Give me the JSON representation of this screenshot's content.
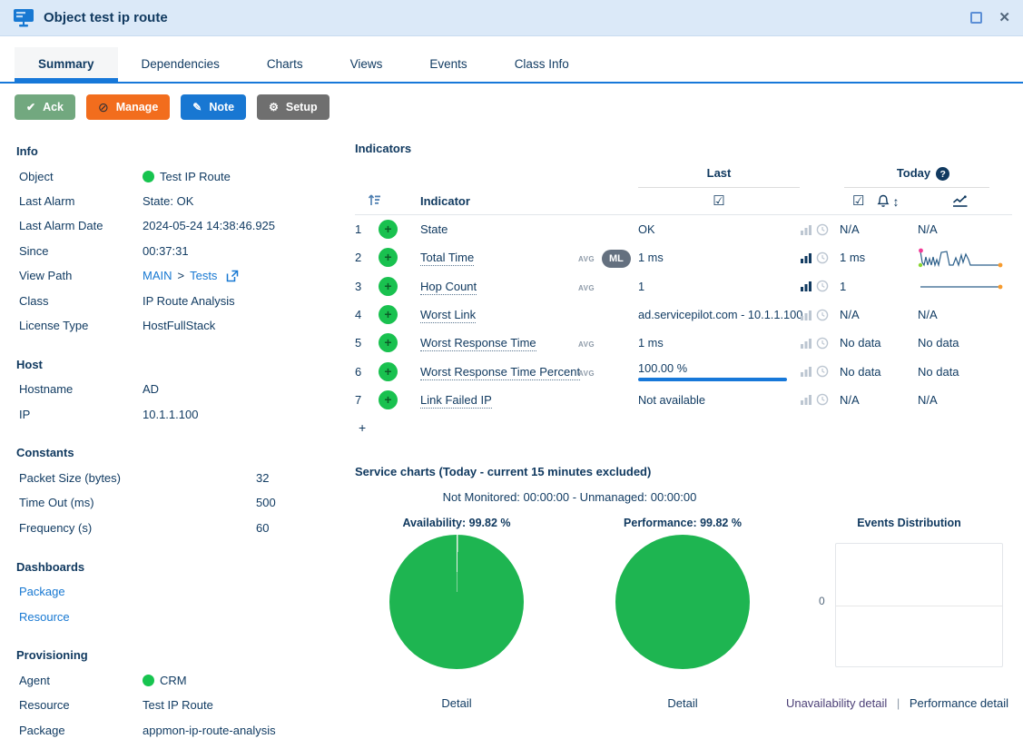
{
  "window": {
    "title": "Object test ip route",
    "close_glyph": "✕"
  },
  "tabs": [
    {
      "label": "Summary",
      "active": true
    },
    {
      "label": "Dependencies",
      "active": false
    },
    {
      "label": "Charts",
      "active": false
    },
    {
      "label": "Views",
      "active": false
    },
    {
      "label": "Events",
      "active": false
    },
    {
      "label": "Class Info",
      "active": false
    }
  ],
  "actions": {
    "ack": "Ack",
    "manage": "Manage",
    "note": "Note",
    "setup": "Setup",
    "ack_icon": "✔",
    "manage_icon": "⊘",
    "note_icon": "✎",
    "setup_icon": "⚙"
  },
  "left": {
    "info": {
      "title": "Info",
      "object_label": "Object",
      "object_value": "Test IP Route",
      "last_alarm_label": "Last Alarm",
      "last_alarm_value": "State: OK",
      "last_alarm_date_label": "Last Alarm Date",
      "last_alarm_date_value": "2024-05-24 14:38:46.925",
      "since_label": "Since",
      "since_value": "00:37:31",
      "view_path_label": "View Path",
      "view_path_link1": "MAIN",
      "view_path_sep": ">",
      "view_path_link2": "Tests",
      "class_label": "Class",
      "class_value": "IP Route Analysis",
      "license_label": "License Type",
      "license_value": "HostFullStack"
    },
    "host": {
      "title": "Host",
      "hostname_label": "Hostname",
      "hostname_value": "AD",
      "ip_label": "IP",
      "ip_value": "10.1.1.100"
    },
    "constants": {
      "title": "Constants",
      "rows": [
        {
          "label": "Packet Size (bytes)",
          "value": "32"
        },
        {
          "label": "Time Out (ms)",
          "value": "500"
        },
        {
          "label": "Frequency (s)",
          "value": "60"
        }
      ]
    },
    "dashboards": {
      "title": "Dashboards",
      "links": [
        "Package",
        "Resource"
      ]
    },
    "provisioning": {
      "title": "Provisioning",
      "agent_label": "Agent",
      "agent_value": "CRM",
      "resource_label": "Resource",
      "resource_value": "Test IP Route",
      "package_label": "Package",
      "package_value": "appmon-ip-route-analysis"
    }
  },
  "indicators": {
    "title": "Indicators",
    "group_last": "Last",
    "group_today": "Today",
    "help_glyph": "?",
    "col_indicator": "Indicator",
    "check_glyph": "☑",
    "updown_glyph": "↕",
    "plus_glyph": "+",
    "add_row_glyph": "+",
    "rows": [
      {
        "num": "1",
        "name": "State",
        "last": "OK",
        "today": "N/A",
        "spark_text": "N/A"
      },
      {
        "num": "2",
        "name": "Total Time",
        "avg": "AVG",
        "ml": "ML",
        "last": "1 ms",
        "today": "1 ms"
      },
      {
        "num": "3",
        "name": "Hop Count",
        "avg": "AVG",
        "last": "1",
        "today": "1"
      },
      {
        "num": "4",
        "name": "Worst Link",
        "last": "ad.servicepilot.com - 10.1.1.100",
        "today": "N/A",
        "spark_text": "N/A"
      },
      {
        "num": "5",
        "name": "Worst Response Time",
        "avg": "AVG",
        "last": "1 ms",
        "today": "No data",
        "spark_text": "No data"
      },
      {
        "num": "6",
        "name": "Worst Response Time Percent",
        "avg": "AVG",
        "last": "100.00 %",
        "today": "No data",
        "spark_text": "No data"
      },
      {
        "num": "7",
        "name": "Link Failed IP",
        "last": "Not available",
        "today": "N/A",
        "spark_text": "N/A"
      }
    ]
  },
  "service_charts": {
    "title": "Service charts (Today - current 15 minutes excluded)",
    "subtitle": "Not Monitored: 00:00:00 - Unmanaged: 00:00:00",
    "availability": {
      "title": "Availability: 99.82 %",
      "value": 99.82,
      "detail": "Detail"
    },
    "performance": {
      "title": "Performance: 99.82 %",
      "value": 99.82,
      "detail": "Detail"
    },
    "events": {
      "title": "Events Distribution",
      "y_zero": "0",
      "link_unavailability": "Unavailability detail",
      "link_separator": "|",
      "link_performance": "Performance detail"
    }
  },
  "colors": {
    "accent_blue": "#1778d9",
    "navy_text": "#113a60",
    "status_green": "#17c44f",
    "pie_green": "#1eb551",
    "manage_orange": "#f26d1d",
    "ack_green": "#72a87f",
    "setup_gray": "#6f6f6f"
  }
}
